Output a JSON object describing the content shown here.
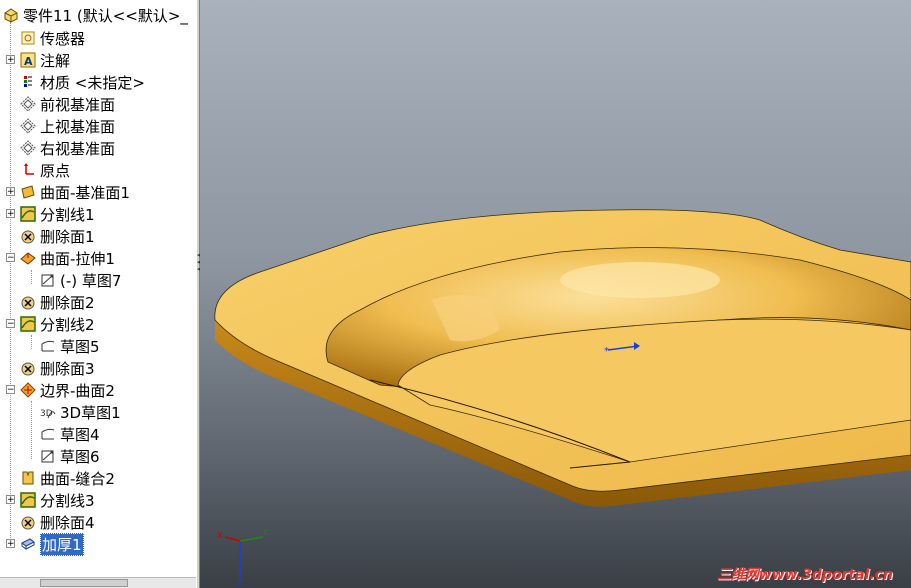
{
  "tree": {
    "root_label": "零件11  (默认<<默认>_",
    "items": [
      {
        "label": "传感器",
        "icon": "sensor-icon"
      },
      {
        "label": "注解",
        "icon": "annotation-icon"
      },
      {
        "label": "材质 <未指定>",
        "icon": "material-icon"
      },
      {
        "label": "前视基准面",
        "icon": "plane-icon"
      },
      {
        "label": "上视基准面",
        "icon": "plane-icon"
      },
      {
        "label": "右视基准面",
        "icon": "plane-icon"
      },
      {
        "label": "原点",
        "icon": "origin-icon"
      },
      {
        "label": "曲面-基准面1",
        "icon": "planar-surface-icon"
      },
      {
        "label": "分割线1",
        "icon": "split-line-icon"
      },
      {
        "label": "删除面1",
        "icon": "delete-face-icon"
      },
      {
        "label": "曲面-拉伸1",
        "icon": "extruded-surface-icon"
      },
      {
        "label": "(-) 草图7",
        "icon": "sketch-icon"
      },
      {
        "label": "删除面2",
        "icon": "delete-face-icon"
      },
      {
        "label": "分割线2",
        "icon": "split-line-icon"
      },
      {
        "label": "草图5",
        "icon": "sketch-icon"
      },
      {
        "label": "删除面3",
        "icon": "delete-face-icon"
      },
      {
        "label": "边界-曲面2",
        "icon": "boundary-surface-icon"
      },
      {
        "label": "3D草图1",
        "icon": "3d-sketch-icon"
      },
      {
        "label": "草图4",
        "icon": "sketch-icon"
      },
      {
        "label": "草图6",
        "icon": "sketch-icon"
      },
      {
        "label": "曲面-缝合2",
        "icon": "knit-surface-icon"
      },
      {
        "label": "分割线3",
        "icon": "split-line-icon"
      },
      {
        "label": "删除面4",
        "icon": "delete-face-icon"
      },
      {
        "label": "加厚1",
        "icon": "thicken-icon"
      }
    ],
    "selected": "加厚1"
  },
  "triad": {
    "x": "X",
    "y": "Y",
    "z": "Z"
  },
  "watermark": "三维网www.3dportal.cn",
  "colors": {
    "part": "#f2c155",
    "selection": "#3169c6",
    "watermark": "#e8342c"
  }
}
